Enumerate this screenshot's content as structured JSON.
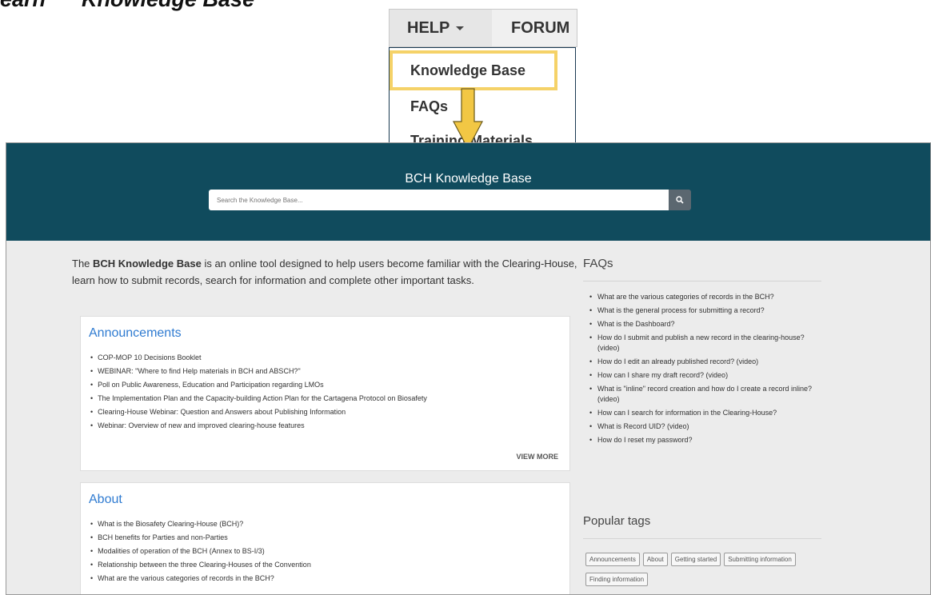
{
  "slide": {
    "title": "earn      Knowledge Base"
  },
  "nav": {
    "help_label": "HELP",
    "forum_label": "FORUM",
    "dropdown_items": [
      "Knowledge Base",
      "FAQs",
      "Training Materials"
    ]
  },
  "kb": {
    "title": "BCH Knowledge Base",
    "search_placeholder": "Search the Knowledge Base...",
    "intro": {
      "prefix": "The ",
      "bold": "BCH Knowledge Base",
      "suffix": " is an online tool designed to help users become familiar with the Clearing-House, learn how to submit records, search for information and complete other important tasks."
    },
    "announcements": {
      "heading": "Announcements",
      "items": [
        "COP-MOP 10 Decisions Booklet",
        "WEBINAR: \"Where to find Help materials in BCH and ABSCH?\"",
        "Poll on Public Awareness, Education and Participation regarding LMOs",
        "The Implementation Plan and the Capacity-building Action Plan for the Cartagena Protocol on Biosafety",
        "Clearing-House Webinar: Question and Answers about Publishing Information",
        "Webinar: Overview of new and improved clearing-house features"
      ],
      "view_more": "VIEW MORE"
    },
    "about": {
      "heading": "About",
      "items": [
        "What is the Biosafety Clearing-House (BCH)?",
        "BCH benefits for Parties and non-Parties",
        "Modalities of operation of the BCH (Annex to BS-I/3)",
        "Relationship between the three Clearing-Houses of the Convention",
        "What are the various categories of records in the BCH?"
      ]
    },
    "faqs": {
      "heading": "FAQs",
      "items": [
        "What are the various categories of records in the BCH?",
        "What is the general process for submitting a record?",
        "What is the Dashboard?",
        "How do I submit and publish a new record in the clearing-house? (video)",
        "How do I edit an already published record? (video)",
        "How can I share my draft record? (video)",
        "What is \"inline\" record creation and how do I create a record inline? (video)",
        "How can I search for information in the Clearing-House?",
        "What is Record UID? (video)",
        "How do I reset my password?"
      ]
    },
    "popular_tags": {
      "heading": "Popular tags",
      "items": [
        "Announcements",
        "About",
        "Getting started",
        "Submitting information",
        "Finding information"
      ]
    }
  },
  "colors": {
    "header_bg": "#104b5d",
    "highlight_border": "#f5d268",
    "arrow": "#f2c744",
    "link_blue": "#2f7bd1"
  }
}
